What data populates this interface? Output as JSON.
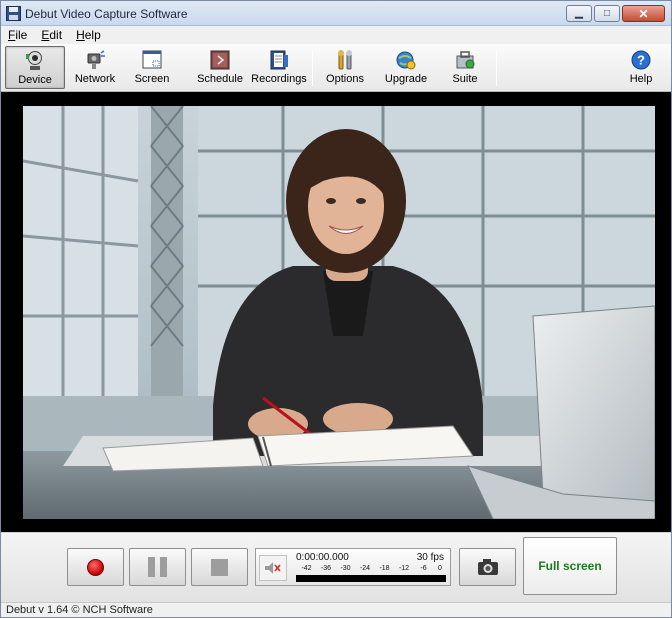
{
  "window": {
    "title": "Debut Video Capture Software"
  },
  "menu": {
    "items": [
      {
        "label": "File",
        "accel": "F",
        "rest": "ile"
      },
      {
        "label": "Edit",
        "accel": "E",
        "rest": "dit"
      },
      {
        "label": "Help",
        "accel": "H",
        "rest": "elp"
      }
    ]
  },
  "toolbar": {
    "device": "Device",
    "network": "Network",
    "screen": "Screen",
    "schedule": "Schedule",
    "recordings": "Recordings",
    "options": "Options",
    "upgrade": "Upgrade",
    "suite": "Suite",
    "help": "Help",
    "active": "Device"
  },
  "preview": {
    "scene": "webcam preview: businesswoman seated at desk with notebook and laptop in office"
  },
  "controls": {
    "time": "0:00:00.000",
    "fps": "30 fps",
    "level_ticks": [
      "-42",
      "-36",
      "-30",
      "-24",
      "-18",
      "-12",
      "-6",
      "0"
    ],
    "fullscreen_label": "Full screen"
  },
  "status": {
    "text": "Debut v 1.64 © NCH Software"
  },
  "colors": {
    "record_red": "#c20000",
    "fullscreen_green": "#1c7a1c"
  }
}
